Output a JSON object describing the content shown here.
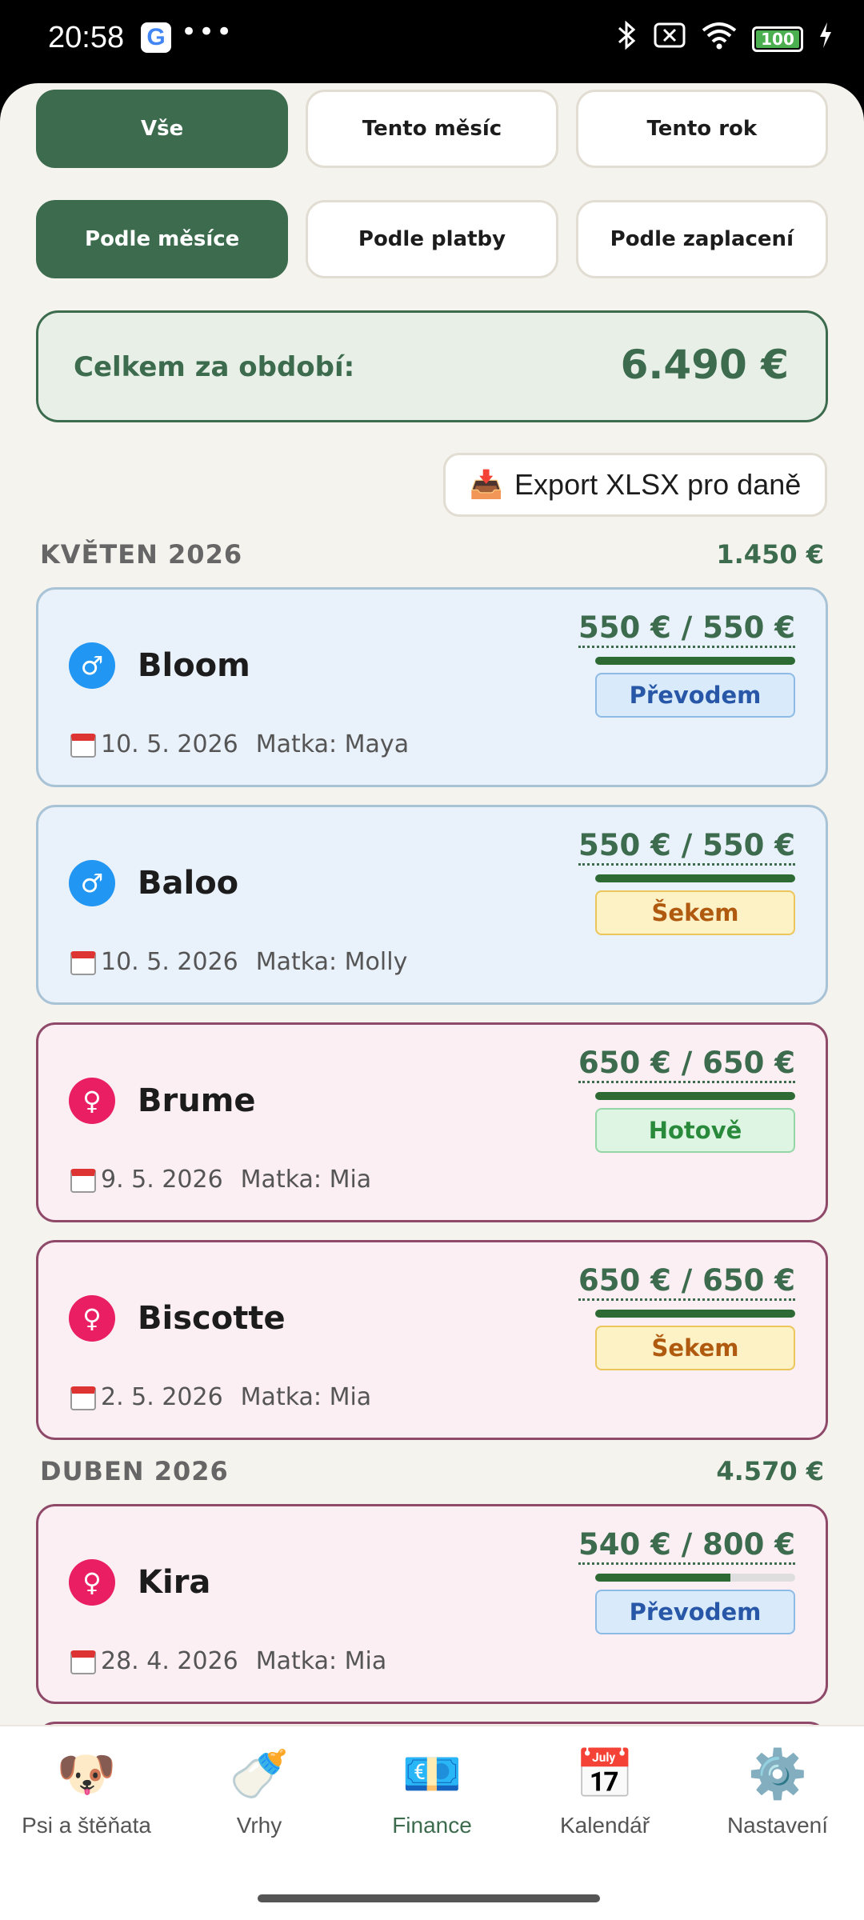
{
  "status_bar": {
    "time": "20:58",
    "g_icon": "G",
    "dots": "•••",
    "battery": "100"
  },
  "filters": {
    "period": [
      {
        "label": "Vše",
        "active": true
      },
      {
        "label": "Tento měsíc",
        "active": false
      },
      {
        "label": "Tento rok",
        "active": false
      }
    ],
    "group": [
      {
        "label": "Podle měsíce",
        "active": true
      },
      {
        "label": "Podle platby",
        "active": false
      },
      {
        "label": "Podle zaplacení",
        "active": false
      }
    ]
  },
  "total": {
    "label": "Celkem za období:",
    "value": "6.490 €"
  },
  "export": {
    "icon": "📥",
    "label": "Export XLSX pro daně"
  },
  "months": [
    {
      "name": "KVĚTEN 2026",
      "total": "1.450 €"
    },
    {
      "name": "DUBEN 2026",
      "total": "4.570 €"
    }
  ],
  "cards": [
    {
      "sex": "male",
      "sex_symbol": "♂",
      "name": "Bloom",
      "date": "10. 5. 2026",
      "mother": "Matka: Maya",
      "amount": "550 € / 550 €",
      "paid_fraction": 1.0,
      "payment": "Převodem",
      "payment_kind": "transfer"
    },
    {
      "sex": "male",
      "sex_symbol": "♂",
      "name": "Baloo",
      "date": "10. 5. 2026",
      "mother": "Matka: Molly",
      "amount": "550 € / 550 €",
      "paid_fraction": 1.0,
      "payment": "Šekem",
      "payment_kind": "cheque"
    },
    {
      "sex": "female",
      "sex_symbol": "♀",
      "name": "Brume",
      "date": "9. 5. 2026",
      "mother": "Matka: Mia",
      "amount": "650 € / 650 €",
      "paid_fraction": 1.0,
      "payment": "Hotově",
      "payment_kind": "cash"
    },
    {
      "sex": "female",
      "sex_symbol": "♀",
      "name": "Biscotte",
      "date": "2. 5. 2026",
      "mother": "Matka: Mia",
      "amount": "650 € / 650 €",
      "paid_fraction": 1.0,
      "payment": "Šekem",
      "payment_kind": "cheque"
    },
    {
      "sex": "female",
      "sex_symbol": "♀",
      "name": "Kira",
      "date": "28. 4. 2026",
      "mother": "Matka: Mia",
      "amount": "540 € / 800 €",
      "paid_fraction": 0.675,
      "payment": "Převodem",
      "payment_kind": "transfer"
    }
  ],
  "nav": [
    {
      "label": "Psi a štěňata",
      "icon": "🐶",
      "icon_name": "dog-icon",
      "active": false
    },
    {
      "label": "Vrhy",
      "icon": "🍼",
      "icon_name": "baby-bottle-icon",
      "active": false
    },
    {
      "label": "Finance",
      "icon": "💶",
      "icon_name": "euro-banknote-icon",
      "active": true
    },
    {
      "label": "Kalendář",
      "icon": "📅",
      "icon_name": "calendar-icon",
      "active": false
    },
    {
      "label": "Nastavení",
      "icon": "⚙️",
      "icon_name": "gear-icon",
      "active": false
    }
  ],
  "colors": {
    "accent": "#3c6b4e",
    "background": "#f5f3ee"
  }
}
